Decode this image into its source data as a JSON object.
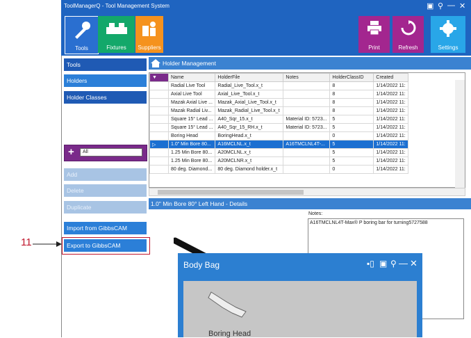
{
  "window": {
    "title": "ToolManagerQ - Tool Management System",
    "controls": [
      "▣",
      "⚲",
      "—",
      "✕"
    ]
  },
  "toolbar": {
    "left": [
      {
        "label": "Tools",
        "color": "#2a6fd0",
        "icon": "tools-icon"
      },
      {
        "label": "Fixtures",
        "color": "#13a86a",
        "icon": "fixtures-icon"
      },
      {
        "label": "Suppliers",
        "color": "#f5921e",
        "icon": "suppliers-icon"
      }
    ],
    "right": [
      {
        "label": "Print",
        "color": "#a3268f",
        "icon": "print-icon"
      },
      {
        "label": "Refresh",
        "color": "#a3268f",
        "icon": "refresh-icon"
      },
      {
        "label": "Settings",
        "color": "#29a6e8",
        "icon": "settings-icon"
      }
    ]
  },
  "sidebar": {
    "nav": [
      "Tools",
      "Holders",
      "Holder Classes"
    ],
    "filter_value": "All",
    "actions": [
      "Add",
      "Delete",
      "Duplicate"
    ],
    "import_label": "Import from GibbsCAM",
    "export_label": "Export to GibbsCAM"
  },
  "holder_management": {
    "title": "Holder Management",
    "columns": [
      "Name",
      "HolderFile",
      "Notes",
      "HolderClassID",
      "Created"
    ],
    "rows": [
      [
        "Radial Live Tool",
        "Radial_Live_Tool.x_t",
        "",
        "8",
        "1/14/2022 11:"
      ],
      [
        "Axial Live Tool",
        "Axial_Live_Tool.x_t",
        "",
        "8",
        "1/14/2022 11:"
      ],
      [
        "Mazak Axial Live ...",
        "Mazak_Axial_Live_Tool.x_t",
        "",
        "8",
        "1/14/2022 11:"
      ],
      [
        "Mazak Radial Liv...",
        "Mazak_Radial_Live_Tool.x_t",
        "",
        "8",
        "1/14/2022 11:"
      ],
      [
        "Square 15° Lead ...",
        "A40_Sqr_15.x_t",
        "Material ID: 5723...",
        "5",
        "1/14/2022 11:"
      ],
      [
        "Square 15° Lead ...",
        "A40_Sqr_15_RH.x_t",
        "Material ID: 5723...",
        "5",
        "1/14/2022 11:"
      ],
      [
        "Boring Head",
        "BoringHead.x_t",
        "",
        "0",
        "1/14/2022 11:"
      ],
      [
        "1.0\" Min Bore 80...",
        "A16MCLNL.x_t",
        "A16TMCLNL4T-...",
        "5",
        "1/14/2022 11:"
      ],
      [
        "1.25 Min Bore 80...",
        "A20MCLNL.x_t",
        "",
        "5",
        "1/14/2022 11:"
      ],
      [
        "1.25 Min Bore 80...",
        "A20MCLNR.x_t",
        "",
        "5",
        "1/14/2022 11:"
      ],
      [
        "80 deg. Diamond...",
        "80 deg. Diamond holder.x_t",
        "",
        "0",
        "1/14/2022 11:"
      ]
    ],
    "selected_row": 7
  },
  "details": {
    "title": "1.0\" Min Bore 80° Left Hand - Details",
    "notes_label": "Notes:",
    "notes_value": "A16TMCLNL4T-Max® P boring bar for turning5727588"
  },
  "popup": {
    "title": "Body Bag",
    "footer_text": "Boring Head"
  },
  "callout": {
    "number": "11",
    "color": "#c0162c"
  }
}
